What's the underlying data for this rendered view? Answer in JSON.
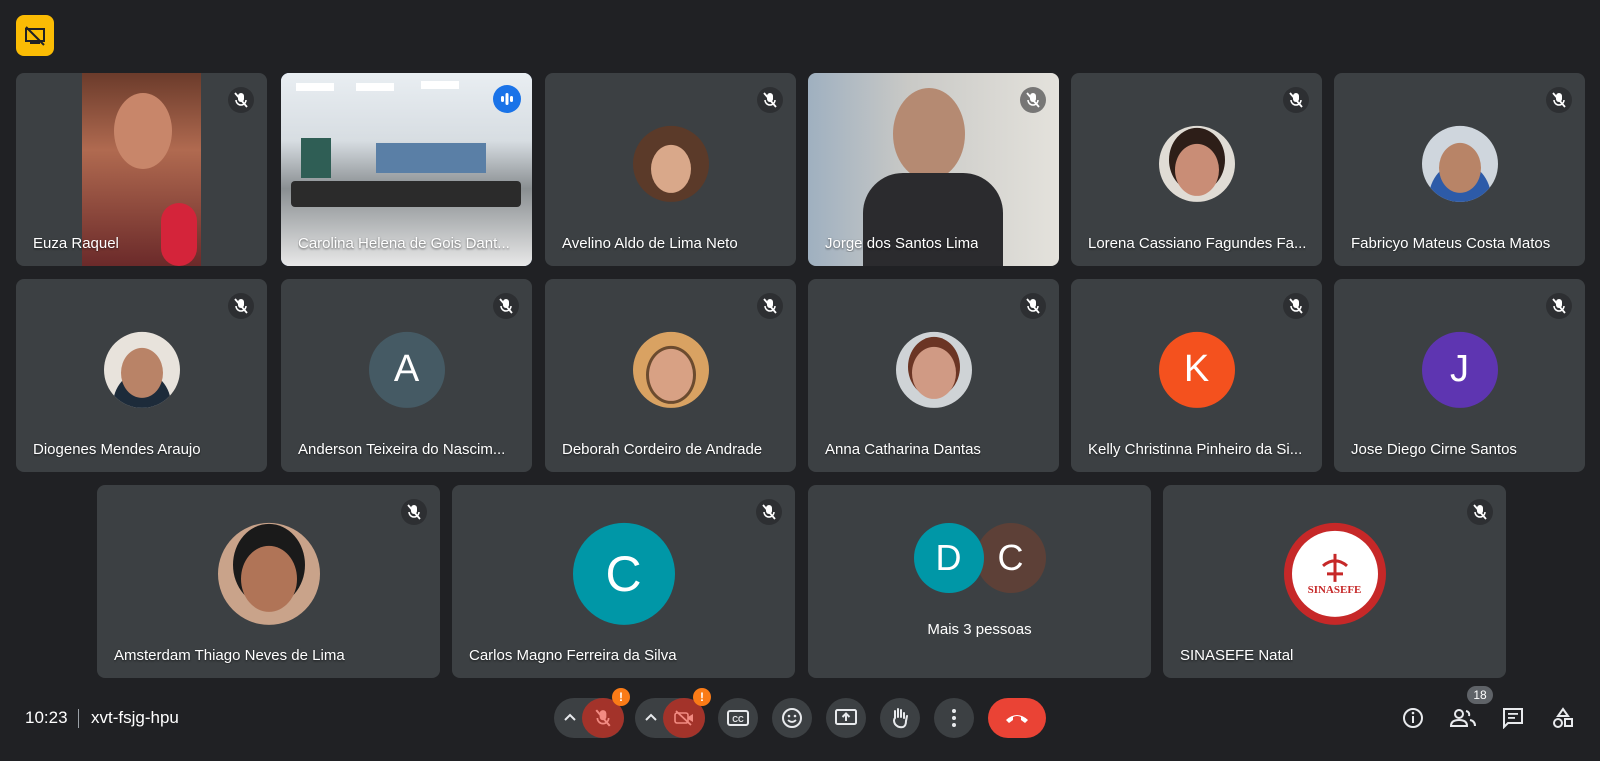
{
  "participants_row1": [
    {
      "name": "Euza Raquel",
      "type": "video",
      "mic_off": true
    },
    {
      "name": "Carolina Helena de Gois Dant...",
      "type": "video",
      "speaking": true
    },
    {
      "name": "Avelino Aldo de Lima Neto",
      "type": "photo",
      "mic_off": true
    },
    {
      "name": "Jorge dos Santos Lima",
      "type": "video",
      "mic_off": true
    },
    {
      "name": "Lorena Cassiano Fagundes Fa...",
      "type": "photo",
      "mic_off": true
    },
    {
      "name": "Fabricyo Mateus Costa Matos",
      "type": "photo",
      "mic_off": true
    }
  ],
  "participants_row2": [
    {
      "name": "Diogenes Mendes Araujo",
      "type": "photo",
      "mic_off": true
    },
    {
      "name": "Anderson Teixeira do Nascim...",
      "type": "letter",
      "letter": "A",
      "color": "#455a64",
      "mic_off": true
    },
    {
      "name": "Deborah Cordeiro de Andrade",
      "type": "photo",
      "mic_off": true
    },
    {
      "name": "Anna Catharina Dantas",
      "type": "photo",
      "mic_off": true
    },
    {
      "name": "Kelly Christinna Pinheiro da Si...",
      "type": "letter",
      "letter": "K",
      "color": "#f4511e",
      "mic_off": true
    },
    {
      "name": "Jose Diego Cirne Santos",
      "type": "letter",
      "letter": "J",
      "color": "#5e35b1",
      "mic_off": true
    }
  ],
  "participants_row3": [
    {
      "name": "Amsterdam Thiago Neves de Lima",
      "type": "photo",
      "mic_off": true
    },
    {
      "name": "Carlos Magno Ferreira da Silva",
      "type": "letter",
      "letter": "C",
      "color": "#0097a7",
      "mic_off": true
    },
    {
      "name": "SINASEFE Natal",
      "type": "logo",
      "mic_off": true
    }
  ],
  "more_tile": {
    "letters": [
      "D",
      "C"
    ],
    "colors": [
      "#0097a7",
      "#5d4037"
    ],
    "label": "Mais 3 pessoas"
  },
  "logo_text": "SINASEFE",
  "meeting": {
    "time": "10:23",
    "code": "xvt-fsjg-hpu"
  },
  "people_count": "18",
  "colors": {
    "background": "#202124",
    "tile": "#3c4043",
    "hangup": "#ea4335",
    "warning": "#fa7b17",
    "speaking": "#1a73e8"
  }
}
